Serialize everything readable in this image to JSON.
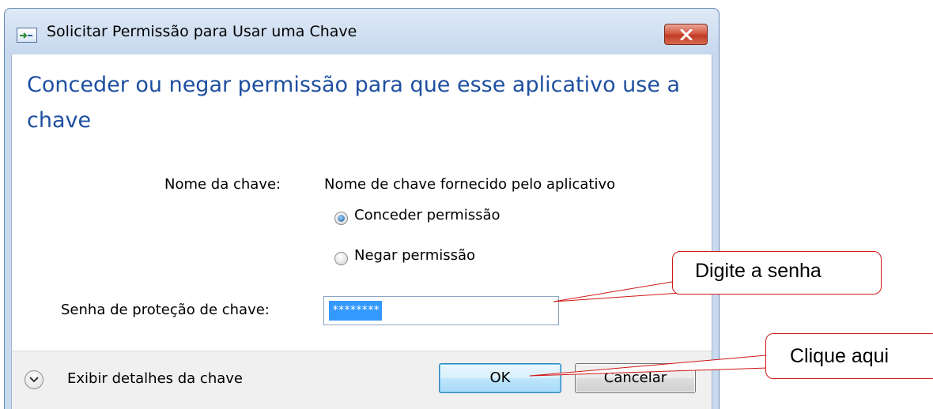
{
  "window": {
    "title": "Solicitar Permissão para Usar uma Chave",
    "heading": "Conceder ou negar permissão para que esse aplicativo use a chave"
  },
  "form": {
    "key_name_label": "Nome da chave:",
    "key_name_value": "Nome de chave fornecido pelo aplicativo",
    "grant_label": "Conceder permissão",
    "deny_label": "Negar permissão",
    "selected_option": "Conceder permissão",
    "password_label": "Senha de proteção de chave:",
    "password_value": "********"
  },
  "footer": {
    "details_label": "Exibir detalhes da chave",
    "ok_label": "OK",
    "cancel_label": "Cancelar"
  },
  "callouts": {
    "password_hint": "Digite a senha",
    "click_hint": "Clique aqui"
  },
  "icons": [
    "app-icon",
    "close-icon",
    "chevron-down-icon"
  ],
  "colors": {
    "heading": "#1e4fa0",
    "callout_border": "#d01818",
    "close_button": "#c03b25",
    "selection": "#3399ff"
  }
}
